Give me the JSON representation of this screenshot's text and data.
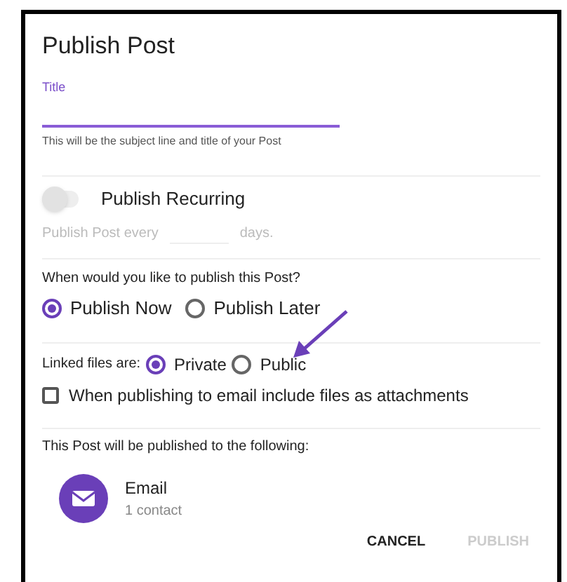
{
  "dialog": {
    "title": "Publish Post"
  },
  "title_field": {
    "label": "Title",
    "helper": "This will be the subject line and title of your Post",
    "focused": true
  },
  "recurring": {
    "label": "Publish Recurring",
    "on": false,
    "every_label": "Publish Post every",
    "days_label": "days."
  },
  "when": {
    "question": "When would you like to publish this Post?",
    "options": [
      {
        "label": "Publish Now",
        "selected": true
      },
      {
        "label": "Publish Later",
        "selected": false
      }
    ]
  },
  "linked_files": {
    "label": "Linked files are:",
    "options": [
      {
        "label": "Private",
        "selected": true
      },
      {
        "label": "Public",
        "selected": false
      }
    ]
  },
  "attachments": {
    "label": "When publishing to email include files as attachments",
    "checked": false
  },
  "destinations": {
    "heading": "This Post will be published to the following:",
    "items": [
      {
        "name": "Email",
        "detail": "1 contact"
      }
    ]
  },
  "buttons": [
    {
      "label": "CANCEL",
      "disabled": false
    },
    {
      "label": "PUBLISH",
      "disabled": true
    }
  ]
}
